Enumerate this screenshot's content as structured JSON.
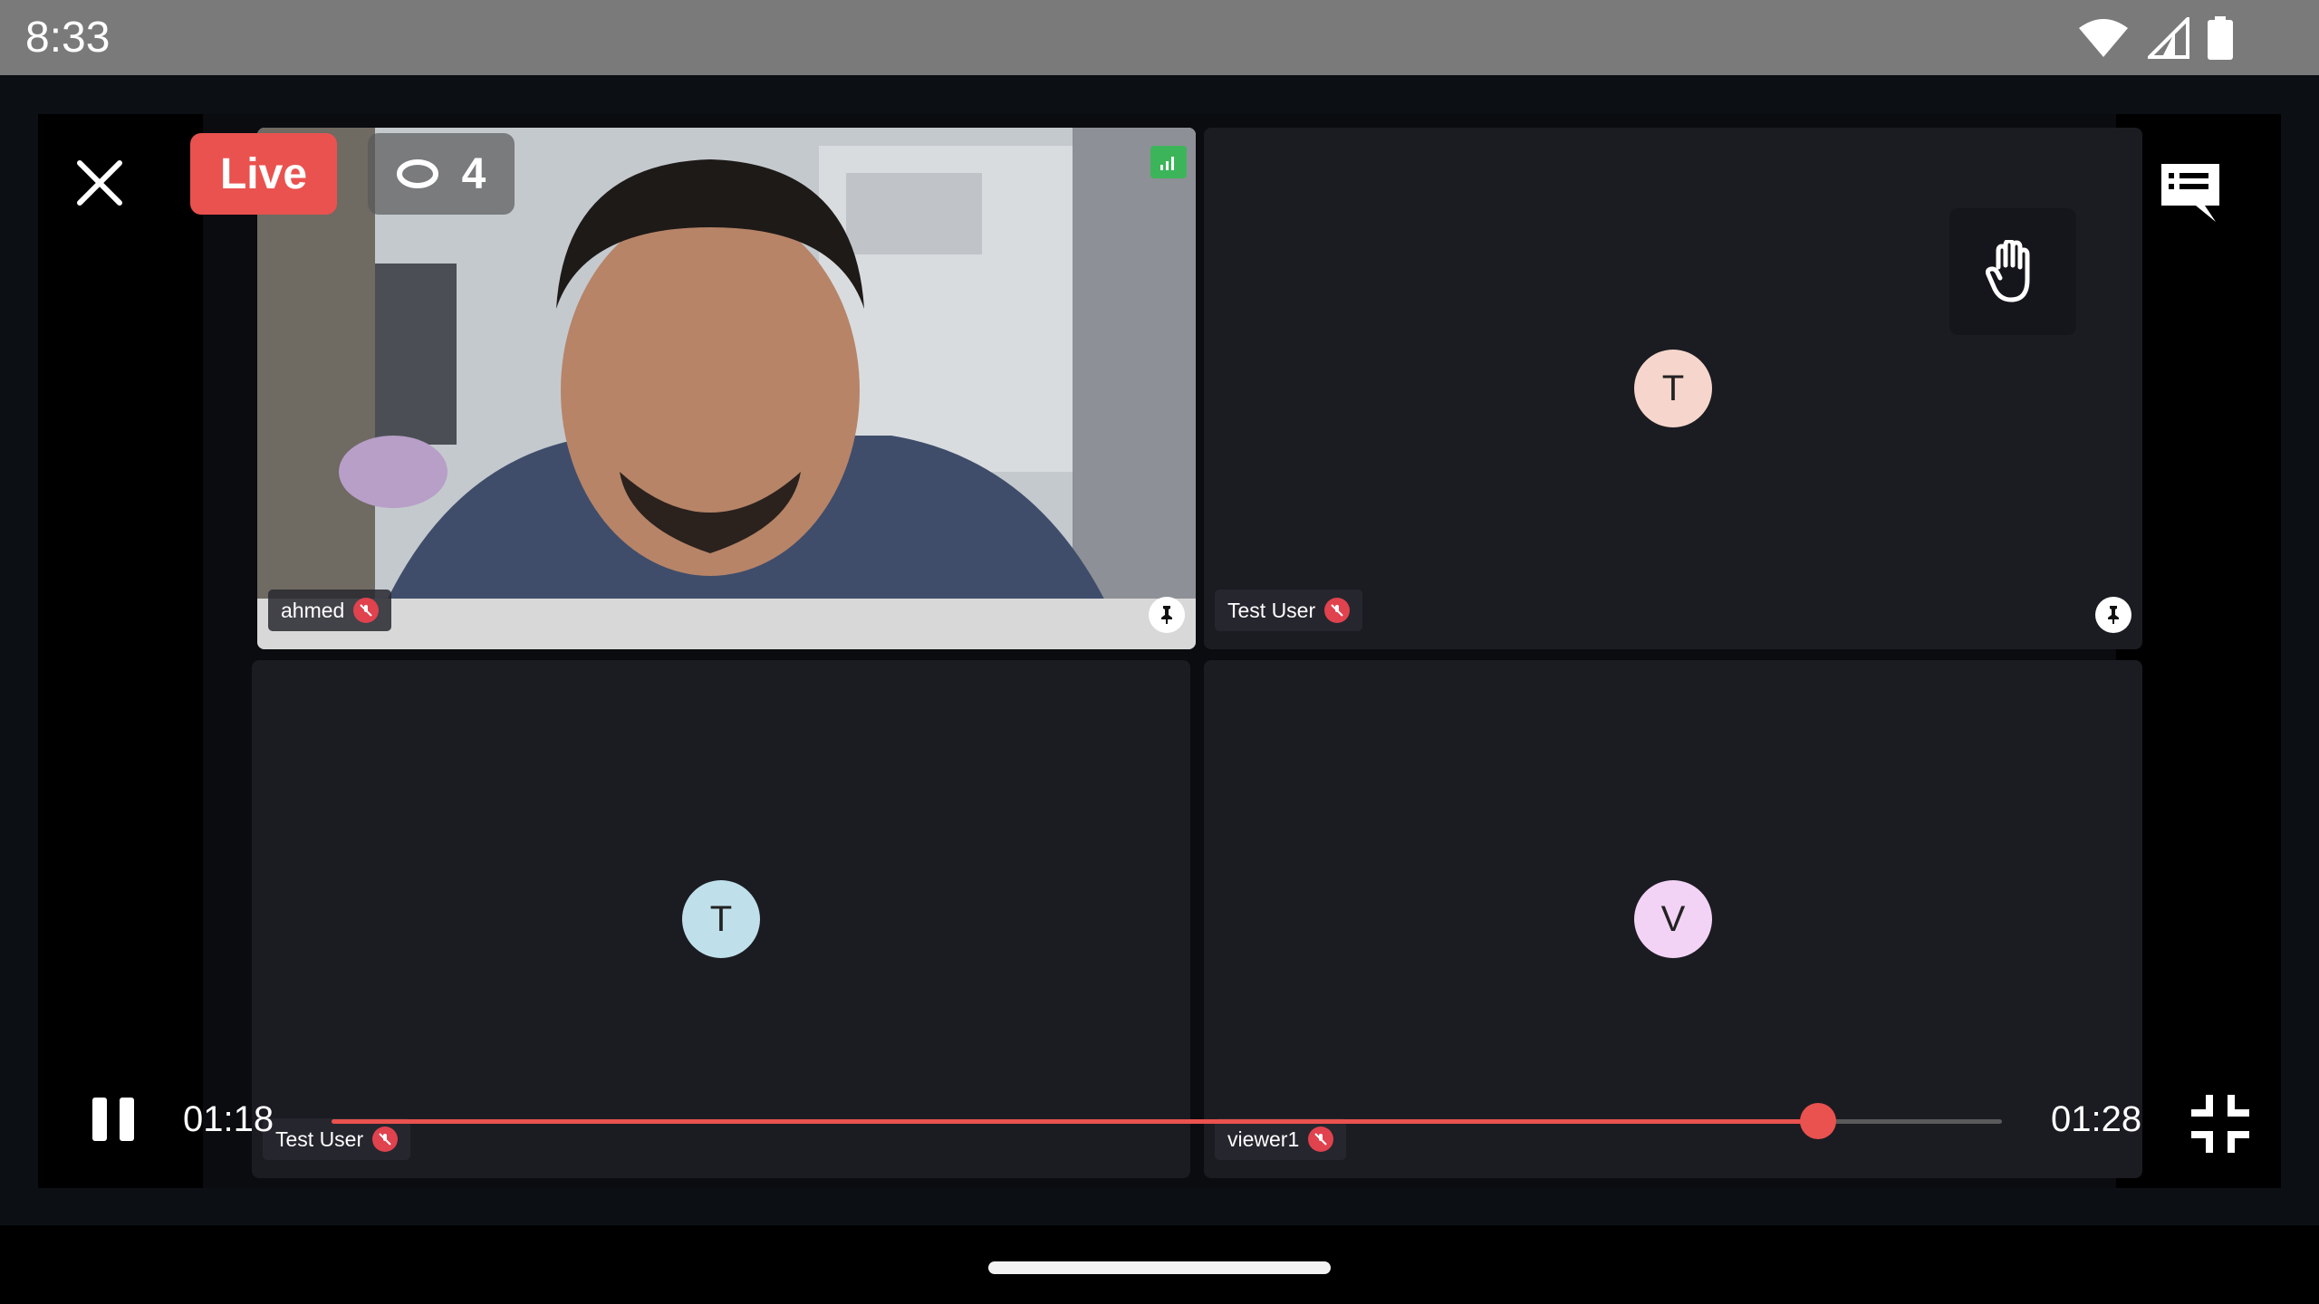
{
  "status_bar": {
    "time": "8:33",
    "icons": [
      "wifi-icon",
      "cell-signal-icon",
      "battery-icon"
    ]
  },
  "header": {
    "live_label": "Live",
    "viewer_count": "4"
  },
  "participants": [
    {
      "name": "ahmed",
      "video": true,
      "mic_muted": true
    },
    {
      "name": "Test User",
      "initial": "T",
      "avatar_color": "#f6d6cc",
      "mic_muted": true
    },
    {
      "name": "Test User",
      "initial": "T",
      "avatar_color": "#bfe0ea",
      "mic_muted": true
    },
    {
      "name": "viewer1",
      "initial": "V",
      "avatar_color": "#f3d3f5",
      "mic_muted": true
    }
  ],
  "playback": {
    "current_time": "01:18",
    "total_time": "01:28",
    "progress": 0.89
  },
  "colors": {
    "accent": "#e9524f",
    "tile_bg": "#1b1c22",
    "signal_good": "#3cb55a"
  }
}
